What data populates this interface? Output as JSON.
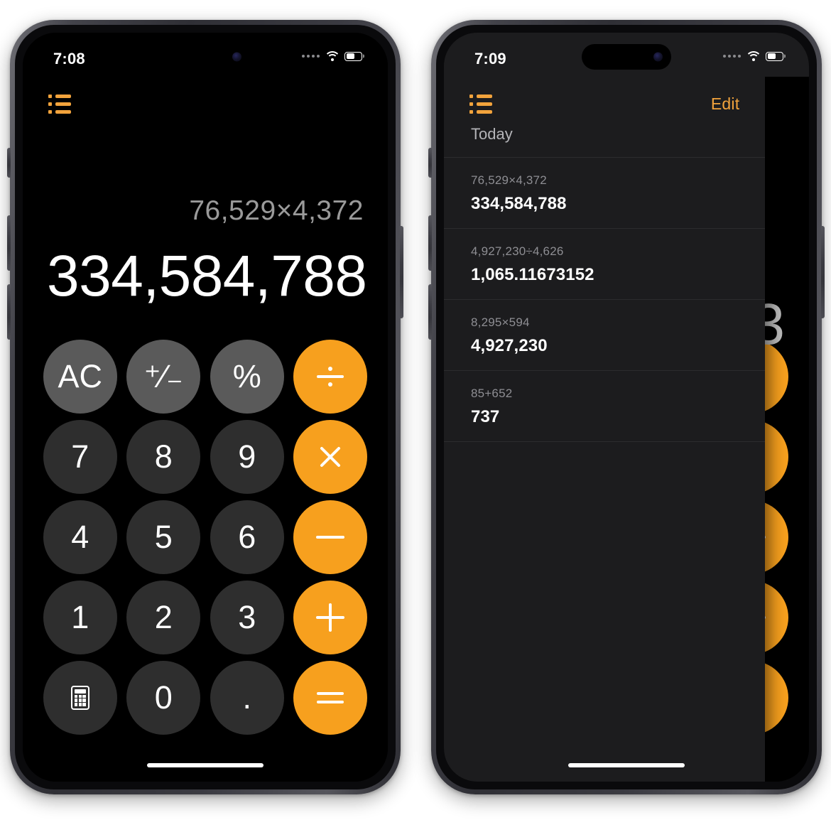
{
  "left_phone": {
    "status_bar": {
      "time": "7:08",
      "signal_icon": "cellular-signal-icon",
      "wifi_icon": "wifi-icon",
      "battery_icon": "battery-icon"
    },
    "nav": {
      "history_icon": "list-icon"
    },
    "display": {
      "expression": "76,529×4,372",
      "result": "334,584,788"
    },
    "keypad": [
      {
        "label": "AC",
        "name": "key-all-clear",
        "style": "fn",
        "glyph": "text"
      },
      {
        "label": "⁺⁄₋",
        "name": "key-sign-toggle",
        "style": "fn",
        "glyph": "text"
      },
      {
        "label": "%",
        "name": "key-percent",
        "style": "fn",
        "glyph": "text"
      },
      {
        "label": "÷",
        "name": "key-divide",
        "style": "op",
        "glyph": "divide"
      },
      {
        "label": "7",
        "name": "key-7",
        "style": "num",
        "glyph": "text"
      },
      {
        "label": "8",
        "name": "key-8",
        "style": "num",
        "glyph": "text"
      },
      {
        "label": "9",
        "name": "key-9",
        "style": "num",
        "glyph": "text"
      },
      {
        "label": "×",
        "name": "key-multiply",
        "style": "op",
        "glyph": "times"
      },
      {
        "label": "4",
        "name": "key-4",
        "style": "num",
        "glyph": "text"
      },
      {
        "label": "5",
        "name": "key-5",
        "style": "num",
        "glyph": "text"
      },
      {
        "label": "6",
        "name": "key-6",
        "style": "num",
        "glyph": "text"
      },
      {
        "label": "−",
        "name": "key-subtract",
        "style": "op",
        "glyph": "minus"
      },
      {
        "label": "1",
        "name": "key-1",
        "style": "num",
        "glyph": "text"
      },
      {
        "label": "2",
        "name": "key-2",
        "style": "num",
        "glyph": "text"
      },
      {
        "label": "3",
        "name": "key-3",
        "style": "num",
        "glyph": "text"
      },
      {
        "label": "+",
        "name": "key-add",
        "style": "op",
        "glyph": "plus"
      },
      {
        "label": "calculator",
        "name": "key-calculator-mode",
        "style": "num",
        "glyph": "calculator"
      },
      {
        "label": "0",
        "name": "key-0",
        "style": "num",
        "glyph": "text"
      },
      {
        "label": ".",
        "name": "key-decimal",
        "style": "num",
        "glyph": "text"
      },
      {
        "label": "=",
        "name": "key-equals",
        "style": "op",
        "glyph": "equals"
      }
    ]
  },
  "right_phone": {
    "status_bar": {
      "time": "7:09",
      "signal_icon": "cellular-signal-icon",
      "wifi_icon": "wifi-icon",
      "battery_icon": "battery-icon"
    },
    "nav": {
      "history_icon": "list-icon",
      "edit_label": "Edit"
    },
    "history": {
      "section_title": "Today",
      "entries": [
        {
          "expression": "76,529×4,372",
          "result": "334,584,788"
        },
        {
          "expression": "4,927,230÷4,626",
          "result": "1,065.11673152"
        },
        {
          "expression": "8,295×594",
          "result": "4,927,230"
        },
        {
          "expression": "85+652",
          "result": "737"
        }
      ]
    },
    "peek_calculator": {
      "result_fragment": "3"
    }
  },
  "colors": {
    "accent_orange": "#F7A01E",
    "function_key": "#5A5A5A",
    "number_key": "#2E2E2E",
    "screen_black": "#000000",
    "panel_background": "#1C1C1E",
    "expression_gray": "#9A9A9A"
  }
}
